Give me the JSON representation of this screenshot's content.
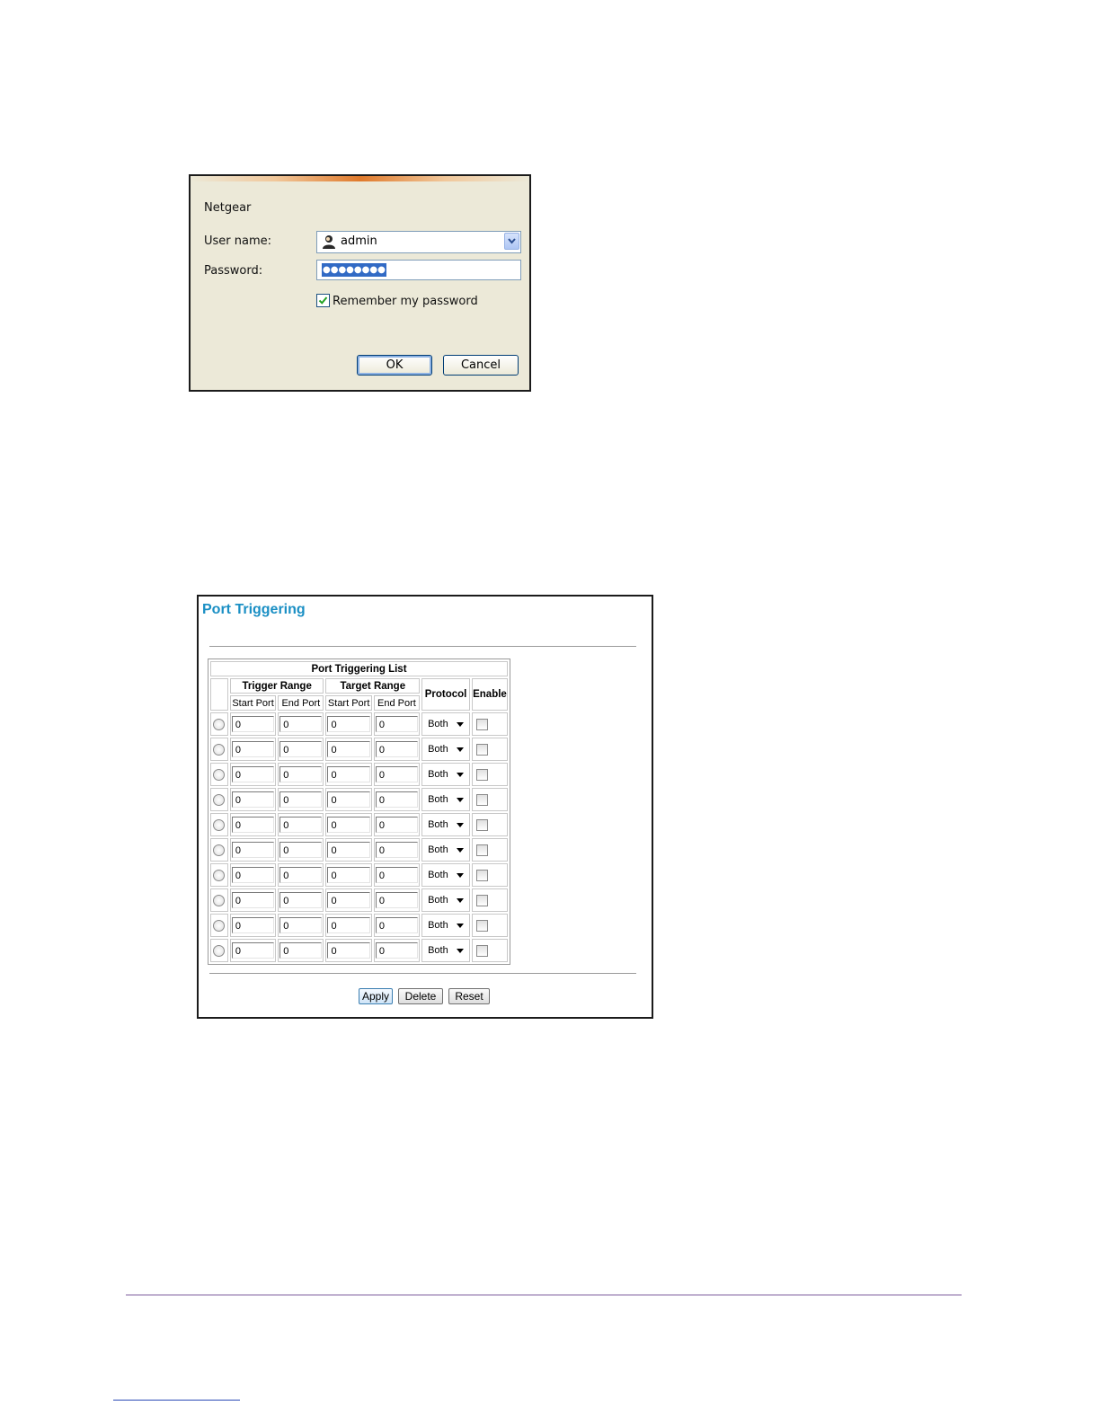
{
  "login_dialog": {
    "realm": "Netgear",
    "username_label": "User name:",
    "username_value": "admin",
    "password_label": "Password:",
    "password_masked": "●●●●●●●●",
    "remember_label": "Remember my password",
    "remember_checked": true,
    "ok_label": "OK",
    "cancel_label": "Cancel"
  },
  "port_triggering": {
    "title": "Port Triggering",
    "list_title": "Port Triggering List",
    "trigger_range_header": "Trigger Range",
    "target_range_header": "Target Range",
    "protocol_header": "Protocol",
    "enable_header": "Enable",
    "start_port_header": "Start Port",
    "end_port_header": "End Port",
    "rows": [
      {
        "trigger_start": "0",
        "trigger_end": "0",
        "target_start": "0",
        "target_end": "0",
        "protocol": "Both"
      },
      {
        "trigger_start": "0",
        "trigger_end": "0",
        "target_start": "0",
        "target_end": "0",
        "protocol": "Both"
      },
      {
        "trigger_start": "0",
        "trigger_end": "0",
        "target_start": "0",
        "target_end": "0",
        "protocol": "Both"
      },
      {
        "trigger_start": "0",
        "trigger_end": "0",
        "target_start": "0",
        "target_end": "0",
        "protocol": "Both"
      },
      {
        "trigger_start": "0",
        "trigger_end": "0",
        "target_start": "0",
        "target_end": "0",
        "protocol": "Both"
      },
      {
        "trigger_start": "0",
        "trigger_end": "0",
        "target_start": "0",
        "target_end": "0",
        "protocol": "Both"
      },
      {
        "trigger_start": "0",
        "trigger_end": "0",
        "target_start": "0",
        "target_end": "0",
        "protocol": "Both"
      },
      {
        "trigger_start": "0",
        "trigger_end": "0",
        "target_start": "0",
        "target_end": "0",
        "protocol": "Both"
      },
      {
        "trigger_start": "0",
        "trigger_end": "0",
        "target_start": "0",
        "target_end": "0",
        "protocol": "Both"
      },
      {
        "trigger_start": "0",
        "trigger_end": "0",
        "target_start": "0",
        "target_end": "0",
        "protocol": "Both"
      }
    ],
    "apply_label": "Apply",
    "delete_label": "Delete",
    "reset_label": "Reset"
  },
  "colors": {
    "title_blue": "#1a8fc4",
    "dialog_bg": "#ece9d8",
    "selection_blue": "#316ac5",
    "footer_rule": "#7b5a9c"
  },
  "icons": {
    "user": "user-icon",
    "dropdown": "chevron-down-icon",
    "check": "check-icon"
  }
}
